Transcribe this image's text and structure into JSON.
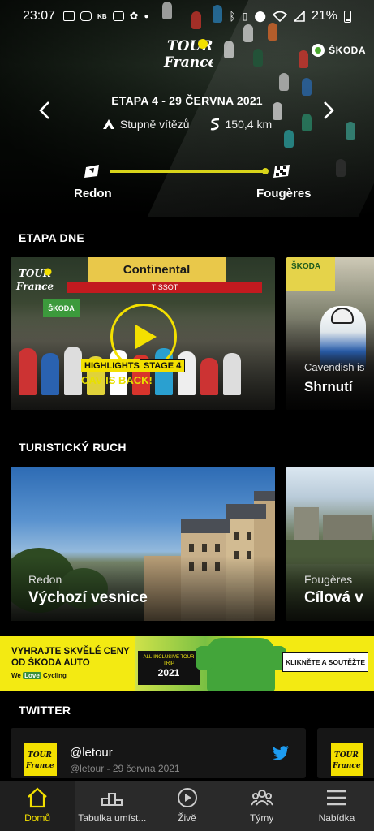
{
  "status_bar": {
    "time": "23:07",
    "left_icons": [
      "message-icon",
      "instagram-icon",
      "kb-icon",
      "fof-icon",
      "fan-icon",
      "dot-icon"
    ],
    "right_icons": [
      "bluetooth-icon",
      "vibrate-icon",
      "location-icon",
      "wifi-icon",
      "signal-icon"
    ],
    "battery": "21%"
  },
  "header": {
    "logo": "tour-de-france-logo",
    "sponsor": "ŠKODA"
  },
  "stage": {
    "title": "ETAPA 4 - 29 ČERVNA 2021",
    "type": "Stupně vítězů",
    "distance": "150,4 km",
    "start": "Redon",
    "finish": "Fougères"
  },
  "etapa_dne": {
    "title": "ETAPA DNE",
    "cards": [
      {
        "tag_highlights": "HIGHLIGHTS",
        "tag_stage": "STAGE 4",
        "caption": "CAV IS BACK!",
        "board_text": "Continental",
        "board_brand": "TISSOT",
        "skoda_board": "ŠKODA"
      },
      {
        "subtitle": "Cavendish is",
        "title": "Shrnutí",
        "sign": "ŠKODA"
      }
    ]
  },
  "turisticky_ruch": {
    "title": "TURISTICKÝ RUCH",
    "cards": [
      {
        "subtitle": "Redon",
        "title": "Výchozí vesnice"
      },
      {
        "subtitle": "Fougères",
        "title": "Cílová v"
      }
    ]
  },
  "ad": {
    "headline_1": "VYHRAJTE SKVĚLÉ CENY",
    "headline_2": "OD ŠKODA AUTO",
    "brand_prefix": "We",
    "brand_love": "Love",
    "brand_suffix": "Cycling",
    "box_text": "ALL-INCLUSIVE TOUR TRIP",
    "box_year": "2021",
    "cta": "KLIKNĚTE A SOUTĚŽTE"
  },
  "twitter": {
    "title": "TWITTER",
    "handle": "@letour",
    "meta": "@letour - 29 června 2021"
  },
  "bottom_nav": {
    "items": [
      {
        "label": "Domů",
        "icon": "home-icon"
      },
      {
        "label": "Tabulka umíst...",
        "icon": "ranking-icon"
      },
      {
        "label": "Živě",
        "icon": "play-circle-icon"
      },
      {
        "label": "Týmy",
        "icon": "teams-icon"
      },
      {
        "label": "Nabídka",
        "icon": "menu-icon"
      }
    ]
  },
  "colors": {
    "accent": "#f3e000",
    "route_line": "#d8d41a",
    "nav_bg": "#2a2a2a",
    "twitter_blue": "#1d9bf0"
  }
}
